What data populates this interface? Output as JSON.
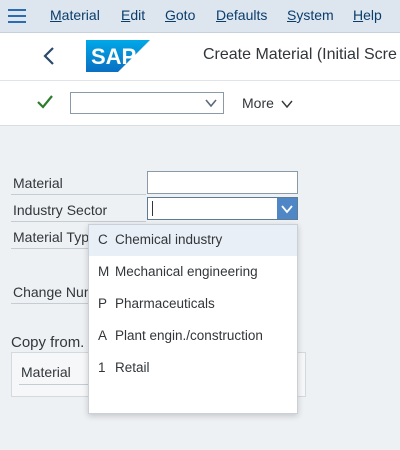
{
  "menubar": {
    "items": [
      {
        "label": "Material",
        "underline": "M",
        "rest": "aterial"
      },
      {
        "label": "Edit",
        "underline": "E",
        "rest": "dit"
      },
      {
        "label": "Goto",
        "underline": "G",
        "rest": "oto"
      },
      {
        "label": "Defaults",
        "underline": "D",
        "rest": "efaults"
      },
      {
        "label": "System",
        "underline": "S",
        "rest": "ystem"
      },
      {
        "label": "Help",
        "underline": "H",
        "rest": "elp"
      }
    ]
  },
  "header": {
    "logo_text": "SAP",
    "title": "Create Material (Initial Scre"
  },
  "toolbar": {
    "command_value": "",
    "more_label": "More"
  },
  "form": {
    "material_label": "Material",
    "material_value": "",
    "industry_label": "Industry Sector",
    "industry_value": "",
    "material_type_label": "Material Typ",
    "change_number_label": "Change Num"
  },
  "copy_from": {
    "title": "Copy from.",
    "material_label": "Material"
  },
  "dropdown": {
    "options": [
      {
        "code": "C",
        "text": "Chemical industry"
      },
      {
        "code": "M",
        "text": "Mechanical engineering"
      },
      {
        "code": "P",
        "text": "Pharmaceuticals"
      },
      {
        "code": "A",
        "text": "Plant engin./construction"
      },
      {
        "code": "1",
        "text": "Retail"
      }
    ],
    "selected_index": 0
  },
  "colors": {
    "menubar_bg": "#dde6ef",
    "accent": "#4f86c6",
    "logo_blue": "#1a8ad4",
    "check_green": "#2b7d2b"
  }
}
